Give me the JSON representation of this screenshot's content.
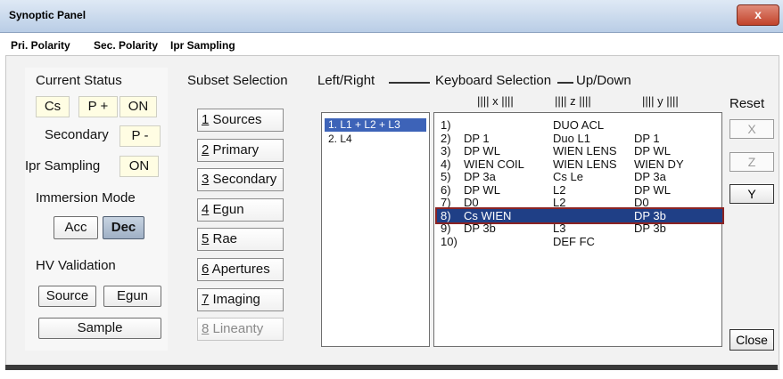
{
  "window": {
    "title": "Synoptic Panel",
    "close_label": "x"
  },
  "menu": [
    "Pri. Polarity",
    "Sec. Polarity",
    "Ipr Sampling"
  ],
  "status": {
    "current_status_label": "Current Status",
    "cs": "Cs",
    "polarity": "P +",
    "on": "ON",
    "secondary_label": "Secondary",
    "secondary_value": "P -",
    "ipr_label": "Ipr Sampling",
    "ipr_value": "ON",
    "immersion_label": "Immersion  Mode",
    "acc": "Acc",
    "dec": "Dec",
    "hv_label": "HV Validation",
    "source": "Source",
    "egun": "Egun",
    "sample": "Sample"
  },
  "subset": {
    "title": "Subset Selection",
    "items": [
      {
        "key": "1",
        "rest": " Sources"
      },
      {
        "key": "2",
        "rest": " Primary"
      },
      {
        "key": "3",
        "rest": " Secondary"
      },
      {
        "key": "4",
        "rest": " Egun"
      },
      {
        "key": "5",
        "rest": " Rae"
      },
      {
        "key": "6",
        "rest": " Apertures"
      },
      {
        "key": "7",
        "rest": " Imaging"
      },
      {
        "key": "8",
        "rest": " Lineanty"
      }
    ]
  },
  "left_right": {
    "title": "Left/Right",
    "items": [
      "1. L1 + L2 + L3",
      "2. L4"
    ]
  },
  "keyboard": {
    "title": "Keyboard Selection",
    "updown": "Up/Down",
    "col_x": "|||| x ||||",
    "col_z": "|||| z ||||",
    "col_y": "|||| y ||||",
    "rows": [
      {
        "n": "1)",
        "x": "",
        "z": "DUO ACL",
        "y": ""
      },
      {
        "n": "2)",
        "x": "DP 1",
        "z": "Duo L1",
        "y": "DP 1"
      },
      {
        "n": "3)",
        "x": "DP WL",
        "z": "WIEN LENS",
        "y": "DP WL"
      },
      {
        "n": "4)",
        "x": "WIEN COIL",
        "z": "WIEN LENS",
        "y": "WIEN DY"
      },
      {
        "n": "5)",
        "x": "DP 3a",
        "z": "Cs Le",
        "y": "DP 3a"
      },
      {
        "n": "6)",
        "x": "DP WL",
        "z": "L2",
        "y": "DP WL"
      },
      {
        "n": "7)",
        "x": "D0",
        "z": "L2",
        "y": "D0"
      },
      {
        "n": "8)",
        "x": "Cs WIEN",
        "z": "",
        "y": "DP 3b"
      },
      {
        "n": "9)",
        "x": "DP 3b",
        "z": "L3",
        "y": "DP 3b"
      },
      {
        "n": "10)",
        "x": "",
        "z": "DEF FC",
        "y": ""
      }
    ]
  },
  "right": {
    "reset": "Reset",
    "x": "X",
    "z": "Z",
    "y": "Y",
    "close": "Close"
  }
}
